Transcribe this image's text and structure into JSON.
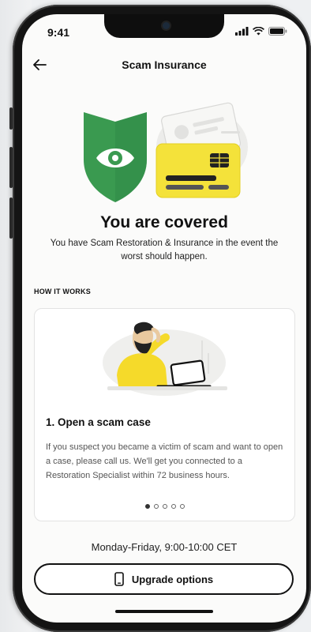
{
  "status": {
    "time": "9:41"
  },
  "header": {
    "title": "Scam Insurance"
  },
  "hero": {
    "headline": "You are covered",
    "subline": "You have Scam Restoration & Insurance in the event the worst should happen."
  },
  "how_it_works": {
    "label": "HOW IT WORKS",
    "step_title": "1. Open a scam case",
    "step_body": "If you suspect you became a victim of scam and want to open a case, please call us. We'll get you connected to a Restoration Specialist within 72 business hours.",
    "pager": {
      "current": 1,
      "total": 5
    }
  },
  "footer": {
    "hours": "Monday-Friday,  9:00-10:00 CET",
    "upgrade_label": "Upgrade options"
  },
  "colors": {
    "shield_green": "#3a9a50",
    "card_yellow": "#f4e23a",
    "shirt_yellow": "#f5da2a"
  }
}
